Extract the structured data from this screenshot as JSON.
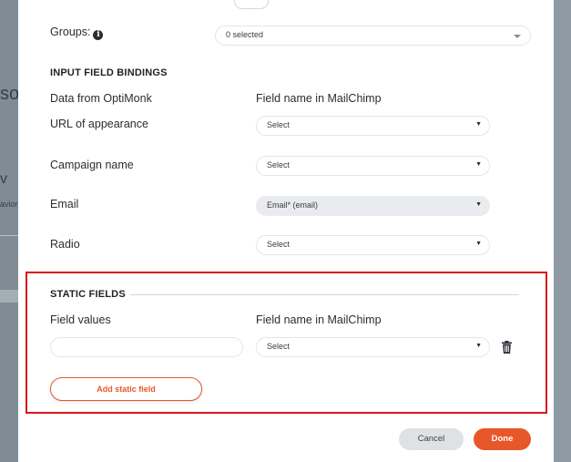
{
  "background": {
    "fragments": [
      "so",
      "v",
      "avior"
    ]
  },
  "groups": {
    "label": "Groups:",
    "info_icon": "info-icon",
    "selected_value": "0 selected"
  },
  "input_bindings": {
    "title": "INPUT FIELD BINDINGS",
    "col_left": "Data from OptiMonk",
    "col_right": "Field name in MailChimp",
    "rows": [
      {
        "label": "URL of appearance",
        "value": "Select",
        "disabled": false
      },
      {
        "label": "Campaign name",
        "value": "Select",
        "disabled": false
      },
      {
        "label": "Email",
        "value": "Email* (email)",
        "disabled": true
      },
      {
        "label": "Radio",
        "value": "Select",
        "disabled": false
      }
    ]
  },
  "static_fields": {
    "title": "STATIC FIELDS",
    "col_left": "Field values",
    "col_right": "Field name in MailChimp",
    "row": {
      "input_value": "",
      "select_value": "Select"
    },
    "delete_icon": "trash-icon",
    "add_button": "Add static field",
    "highlight_color": "#d9151b"
  },
  "footer": {
    "cancel": "Cancel",
    "done": "Done"
  },
  "colors": {
    "accent": "#e8572a",
    "overlay": "#8e9ba4"
  },
  "icons": {
    "dropdown": "▼"
  }
}
